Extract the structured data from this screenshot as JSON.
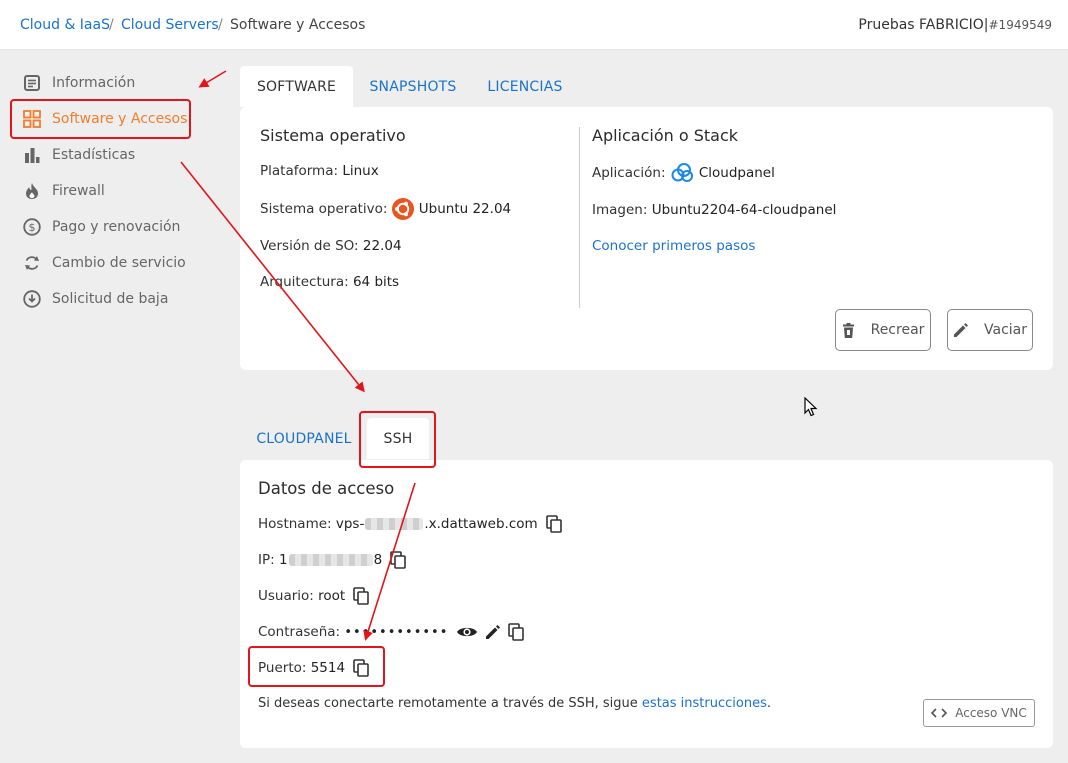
{
  "breadcrumb": {
    "items": [
      "Cloud & IaaS",
      "Cloud Servers",
      "Software y Accesos"
    ],
    "separator": "/"
  },
  "account": {
    "name": "Pruebas FABRICIO|",
    "number": "#1949549"
  },
  "sidebar": {
    "items": [
      {
        "label": "Información",
        "icon": "document-icon"
      },
      {
        "label": "Software y Accesos",
        "icon": "grid-icon",
        "active": true
      },
      {
        "label": "Estadísticas",
        "icon": "bar-chart-icon"
      },
      {
        "label": "Firewall",
        "icon": "flame-icon"
      },
      {
        "label": "Pago y renovación",
        "icon": "dollar-icon"
      },
      {
        "label": "Cambio de servicio",
        "icon": "refresh-icon"
      },
      {
        "label": "Solicitud de baja",
        "icon": "download-circle-icon"
      }
    ]
  },
  "tabs_top": [
    "SOFTWARE",
    "SNAPSHOTS",
    "LICENCIAS"
  ],
  "software": {
    "os_title": "Sistema operativo",
    "platform_label": "Plataforma:",
    "platform_value": "Linux",
    "os_label": "Sistema operativo:",
    "os_value": "Ubuntu 22.04",
    "version_label": "Versión de SO:",
    "version_value": "22.04",
    "arch_label": "Arquitectura:",
    "arch_value": "64 bits",
    "app_title": "Aplicación o Stack",
    "app_label": "Aplicación:",
    "app_value": "Cloudpanel",
    "image_label": "Imagen:",
    "image_value": "Ubuntu2204-64-cloudpanel",
    "first_steps": "Conocer primeros pasos",
    "recreate_button": "Recrear",
    "empty_button": "Vaciar"
  },
  "tabs_access": [
    "CLOUDPANEL",
    "SSH"
  ],
  "ssh": {
    "title": "Datos de acceso",
    "hostname_label": "Hostname:",
    "hostname_prefix": "vps-",
    "hostname_suffix": ".x.dattaweb.com",
    "ip_label": "IP:",
    "ip_prefix": "1",
    "ip_suffix": "8",
    "user_label": "Usuario:",
    "user_value": "root",
    "password_label": "Contraseña:",
    "password_value": "••••••••••••",
    "port_label": "Puerto:",
    "port_value": "5514",
    "instructions_text": "Si deseas conectarte remotamente a través de SSH, sigue ",
    "instructions_link": "estas instrucciones",
    "instructions_end": ".",
    "vnc_button": "Acceso VNC"
  },
  "colors": {
    "accent": "#f07e2e",
    "link": "#1a73c9",
    "annotation": "#e3151b"
  }
}
